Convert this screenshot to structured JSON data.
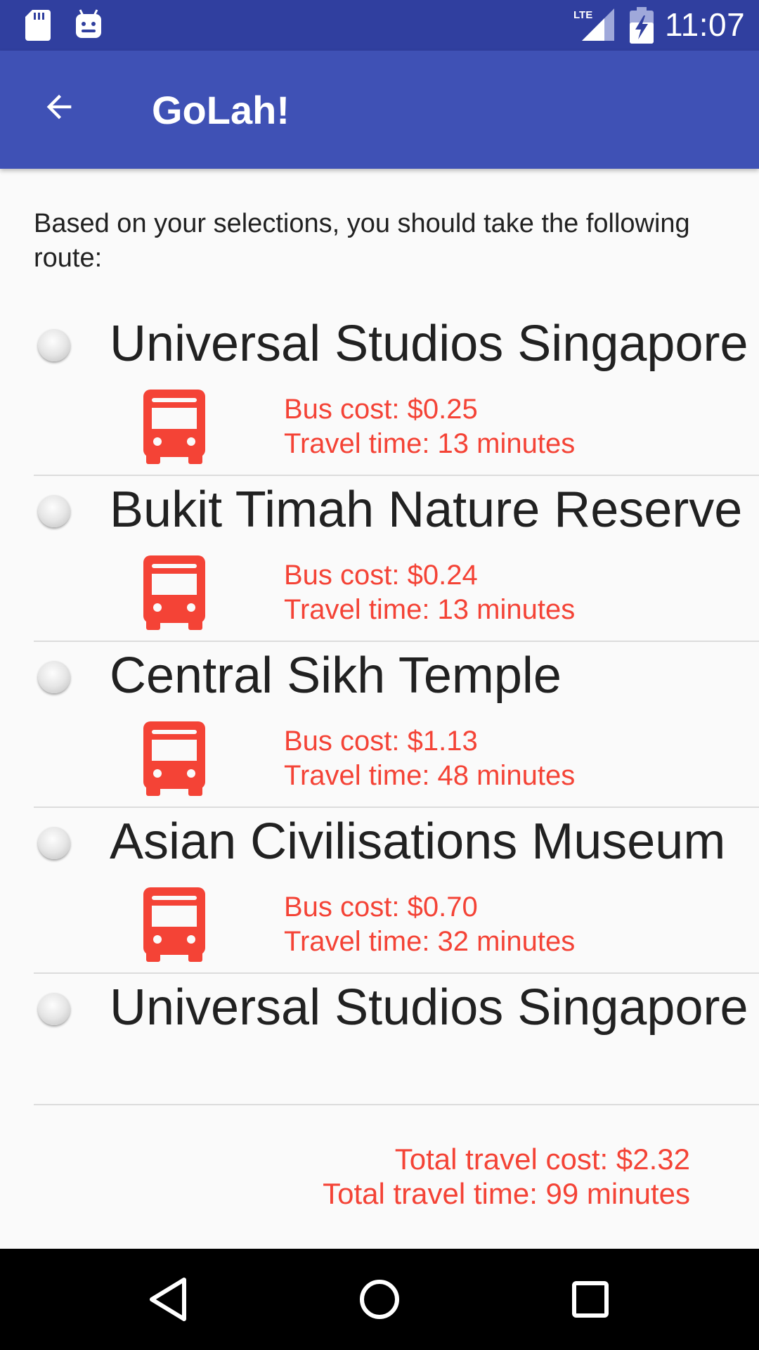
{
  "status_bar": {
    "time": "11:07",
    "icons": [
      "sd-card-icon",
      "android-icon",
      "lte-signal-icon",
      "battery-charging-icon"
    ]
  },
  "app_bar": {
    "title": "GoLah!",
    "back_icon": "arrow-back-icon"
  },
  "intro_text": "Based on your selections, you should take the following route:",
  "route": [
    {
      "name": "Universal Studios Singapore",
      "mode_icon": "bus-icon",
      "cost": "Bus cost: $0.25",
      "time": "Travel time: 13 minutes"
    },
    {
      "name": "Bukit Timah Nature Reserve",
      "mode_icon": "bus-icon",
      "cost": "Bus cost: $0.24",
      "time": "Travel time: 13 minutes"
    },
    {
      "name": "Central Sikh Temple",
      "mode_icon": "bus-icon",
      "cost": "Bus cost: $1.13",
      "time": "Travel time: 48 minutes"
    },
    {
      "name": "Asian Civilisations Museum",
      "mode_icon": "bus-icon",
      "cost": "Bus cost: $0.70",
      "time": "Travel time: 32 minutes"
    },
    {
      "name": "Universal Studios Singapore"
    }
  ],
  "totals": {
    "cost": "Total travel cost: $2.32",
    "time": "Total travel time: 99 minutes"
  },
  "colors": {
    "status_bar": "#303f9f",
    "app_bar": "#3f51b5",
    "accent_red": "#f44336",
    "background": "#fafafa"
  },
  "nav_bar": {
    "icons": [
      "nav-back-icon",
      "nav-home-icon",
      "nav-recents-icon"
    ]
  }
}
